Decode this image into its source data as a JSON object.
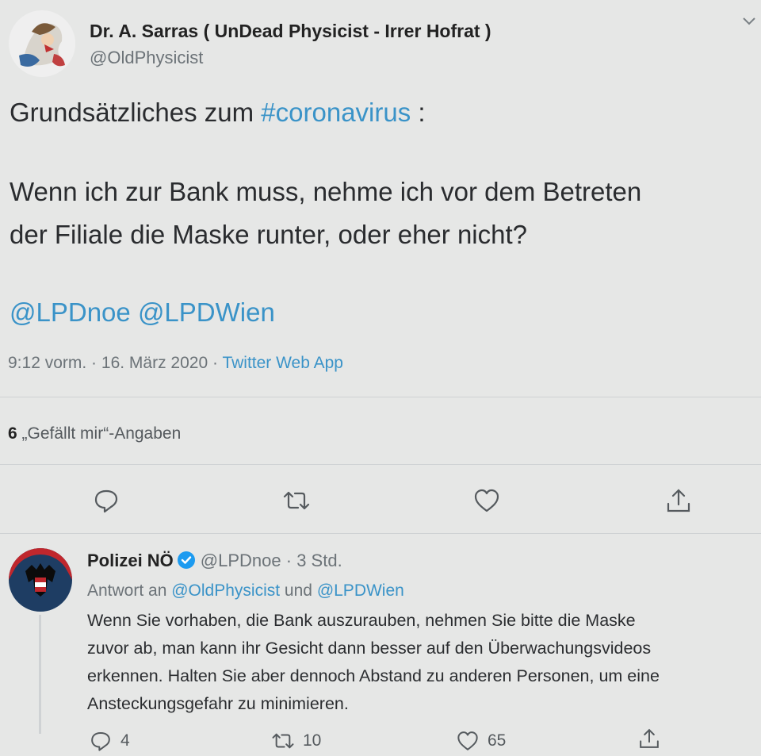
{
  "main_tweet": {
    "display_name": "Dr. A. Sarras ( UnDead Physicist - Irrer Hofrat )",
    "handle": "@OldPhysicist",
    "text_line1_prefix": "Grundsätzliches zum ",
    "hashtag": "#coronavirus",
    "text_line1_suffix": " :",
    "text_line2": "Wenn ich zur Bank muss, nehme ich vor dem Betreten",
    "text_line3": "der Filiale die Maske runter, oder eher nicht?",
    "mention1": "@LPDnoe",
    "mention2": "@LPDWien",
    "time": "9:12 vorm.",
    "date": "16. März 2020",
    "source": "Twitter Web App",
    "like_count": "6",
    "like_label": "„Gefällt mir“-Angaben",
    "actions": [
      "reply-icon",
      "retweet-icon",
      "like-icon",
      "share-icon"
    ]
  },
  "reply_tweet": {
    "display_name": "Polizei NÖ",
    "handle": "@LPDnoe",
    "time_ago": "3 Std.",
    "reply_to_prefix": "Antwort an ",
    "reply_to_user1": "@OldPhysicist",
    "reply_to_and": " und ",
    "reply_to_user2": "@LPDWien",
    "text_lines": [
      "Wenn Sie vorhaben, die Bank auszurauben, nehmen Sie bitte die Maske",
      "zuvor ab, man kann ihr Gesicht dann besser auf den Überwachungsvideos",
      "erkennen. Halten Sie aber dennoch Abstand zu anderen Personen, um eine",
      "Ansteckungsgefahr zu minimieren."
    ],
    "reply_count": "4",
    "retweet_count": "10",
    "like_count": "65"
  },
  "colors": {
    "link": "#3a93c8",
    "background": "#e6e7e6",
    "verified": "#1d9bf0"
  }
}
